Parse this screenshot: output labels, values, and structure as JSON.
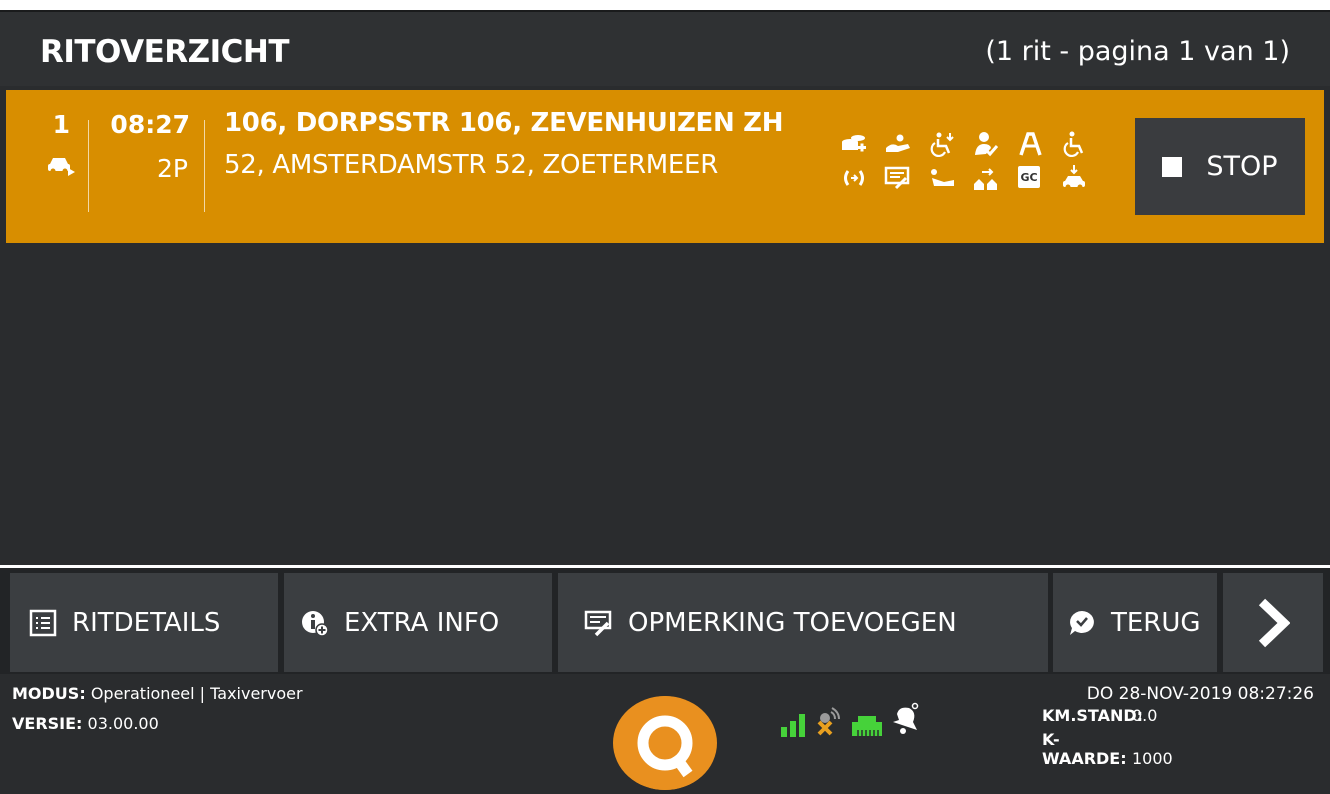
{
  "header": {
    "title": "RITOVERZICHT",
    "pager": "(1 rit - pagina 1 van 1)"
  },
  "ride": {
    "number": "1",
    "time": "08:27",
    "passengers": "2P",
    "from": "106, DORPSSTR 106, ZEVENHUIZEN ZH",
    "to": "52, AMSTERDAMSTR 52, ZOETERMEER",
    "icons_row1": [
      "money-stack-icon",
      "handshake-icon",
      "wheelchair-icon",
      "person-check-icon",
      "walker-icon",
      "wheelchair-icon"
    ],
    "icons_row2": [
      "phone-callback-icon",
      "comment-icon",
      "reclining-person-icon",
      "houses-arrow-icon",
      "gc-badge-icon",
      "car-drop-icon"
    ],
    "gc_label": "GC",
    "stop_label": "STOP",
    "accent_color": "#d88e00"
  },
  "toolbar": {
    "ritdetails": "RITDETAILS",
    "extra_info": "EXTRA INFO",
    "opmerking": "OPMERKING TOEVOEGEN",
    "terug": "TERUG"
  },
  "status": {
    "modus_label": "MODUS:",
    "modus_value": "Operationeel | Taxivervoer",
    "versie_label": "VERSIE:",
    "versie_value": "03.00.00",
    "datetime": "DO 28-NOV-2019 08:27:26",
    "km_label": "KM.STAND:",
    "km_value": "0.0",
    "kwaarde_label": "K-WAARDE:",
    "kwaarde_value": "1000",
    "signal_color": "#46d23a",
    "gps_error_color": "#e8a020"
  }
}
